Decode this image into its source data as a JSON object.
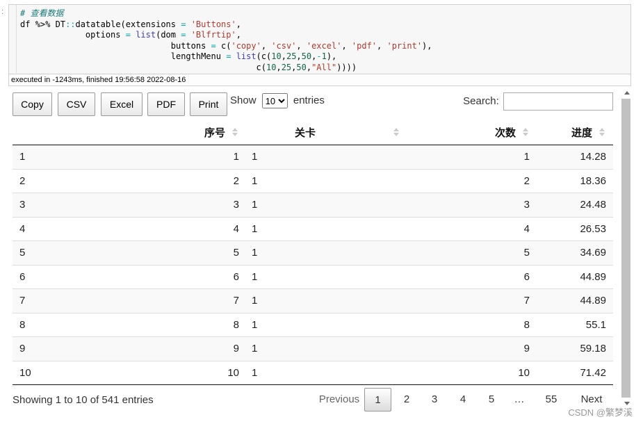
{
  "notebook": {
    "gutter_mark": ":",
    "code_lines": [
      {
        "parts": [
          [
            "comment",
            "# 查看数据"
          ]
        ]
      },
      {
        "parts": [
          [
            "plain",
            "df "
          ],
          [
            "kw",
            "%>%"
          ],
          [
            "plain",
            " DT"
          ],
          [
            "op",
            "::"
          ],
          [
            "plain",
            "datatable(extensions "
          ],
          [
            "op",
            "="
          ],
          [
            "plain",
            " "
          ],
          [
            "str",
            "'Buttons'"
          ],
          [
            "plain",
            ","
          ]
        ]
      },
      {
        "parts": [
          [
            "plain",
            "             options "
          ],
          [
            "op",
            "="
          ],
          [
            "plain",
            " "
          ],
          [
            "fn",
            "list"
          ],
          [
            "plain",
            "(dom "
          ],
          [
            "op",
            "="
          ],
          [
            "plain",
            " "
          ],
          [
            "str",
            "'Blfrtip'"
          ],
          [
            "plain",
            ","
          ]
        ]
      },
      {
        "parts": [
          [
            "plain",
            "                              buttons "
          ],
          [
            "op",
            "="
          ],
          [
            "plain",
            " c("
          ],
          [
            "str",
            "'copy'"
          ],
          [
            "plain",
            ", "
          ],
          [
            "str",
            "'csv'"
          ],
          [
            "plain",
            ", "
          ],
          [
            "str",
            "'excel'"
          ],
          [
            "plain",
            ", "
          ],
          [
            "str",
            "'pdf'"
          ],
          [
            "plain",
            ", "
          ],
          [
            "str",
            "'print'"
          ],
          [
            "plain",
            "),"
          ]
        ]
      },
      {
        "parts": [
          [
            "plain",
            "                              lengthMenu "
          ],
          [
            "op",
            "="
          ],
          [
            "plain",
            " "
          ],
          [
            "fn",
            "list"
          ],
          [
            "plain",
            "(c("
          ],
          [
            "num",
            "10"
          ],
          [
            "plain",
            ","
          ],
          [
            "num",
            "25"
          ],
          [
            "plain",
            ","
          ],
          [
            "num",
            "50"
          ],
          [
            "plain",
            ","
          ],
          [
            "op",
            "-"
          ],
          [
            "num",
            "1"
          ],
          [
            "plain",
            "),"
          ]
        ]
      },
      {
        "parts": [
          [
            "plain",
            "                                               c("
          ],
          [
            "num",
            "10"
          ],
          [
            "plain",
            ","
          ],
          [
            "num",
            "25"
          ],
          [
            "plain",
            ","
          ],
          [
            "num",
            "50"
          ],
          [
            "plain",
            ","
          ],
          [
            "str",
            "\"All\""
          ],
          [
            "plain",
            "))))"
          ]
        ]
      }
    ],
    "exec_info": "executed in -1243ms, finished 19:56:58 2022-08-16"
  },
  "toolbar": {
    "buttons": [
      "Copy",
      "CSV",
      "Excel",
      "PDF",
      "Print"
    ],
    "show_label": "Show",
    "entries_label": "entries",
    "length_selected": "10",
    "search_label": "Search:",
    "search_value": ""
  },
  "table": {
    "columns": [
      "",
      "序号",
      "关卡",
      "次数",
      "进度"
    ],
    "rows": [
      [
        "1",
        "1",
        "1",
        "1",
        "14.28"
      ],
      [
        "2",
        "2",
        "1",
        "2",
        "18.36"
      ],
      [
        "3",
        "3",
        "1",
        "3",
        "24.48"
      ],
      [
        "4",
        "4",
        "1",
        "4",
        "26.53"
      ],
      [
        "5",
        "5",
        "1",
        "5",
        "34.69"
      ],
      [
        "6",
        "6",
        "1",
        "6",
        "44.89"
      ],
      [
        "7",
        "7",
        "1",
        "7",
        "44.89"
      ],
      [
        "8",
        "8",
        "1",
        "8",
        "55.1"
      ],
      [
        "9",
        "9",
        "1",
        "9",
        "59.18"
      ],
      [
        "10",
        "10",
        "1",
        "10",
        "71.42"
      ]
    ]
  },
  "footer": {
    "info": "Showing 1 to 10 of 541 entries",
    "previous": "Previous",
    "pages": [
      "1",
      "2",
      "3",
      "4",
      "5",
      "…",
      "55"
    ],
    "current_page": "1",
    "next": "Next"
  },
  "watermark": "CSDN @繁梦溪"
}
